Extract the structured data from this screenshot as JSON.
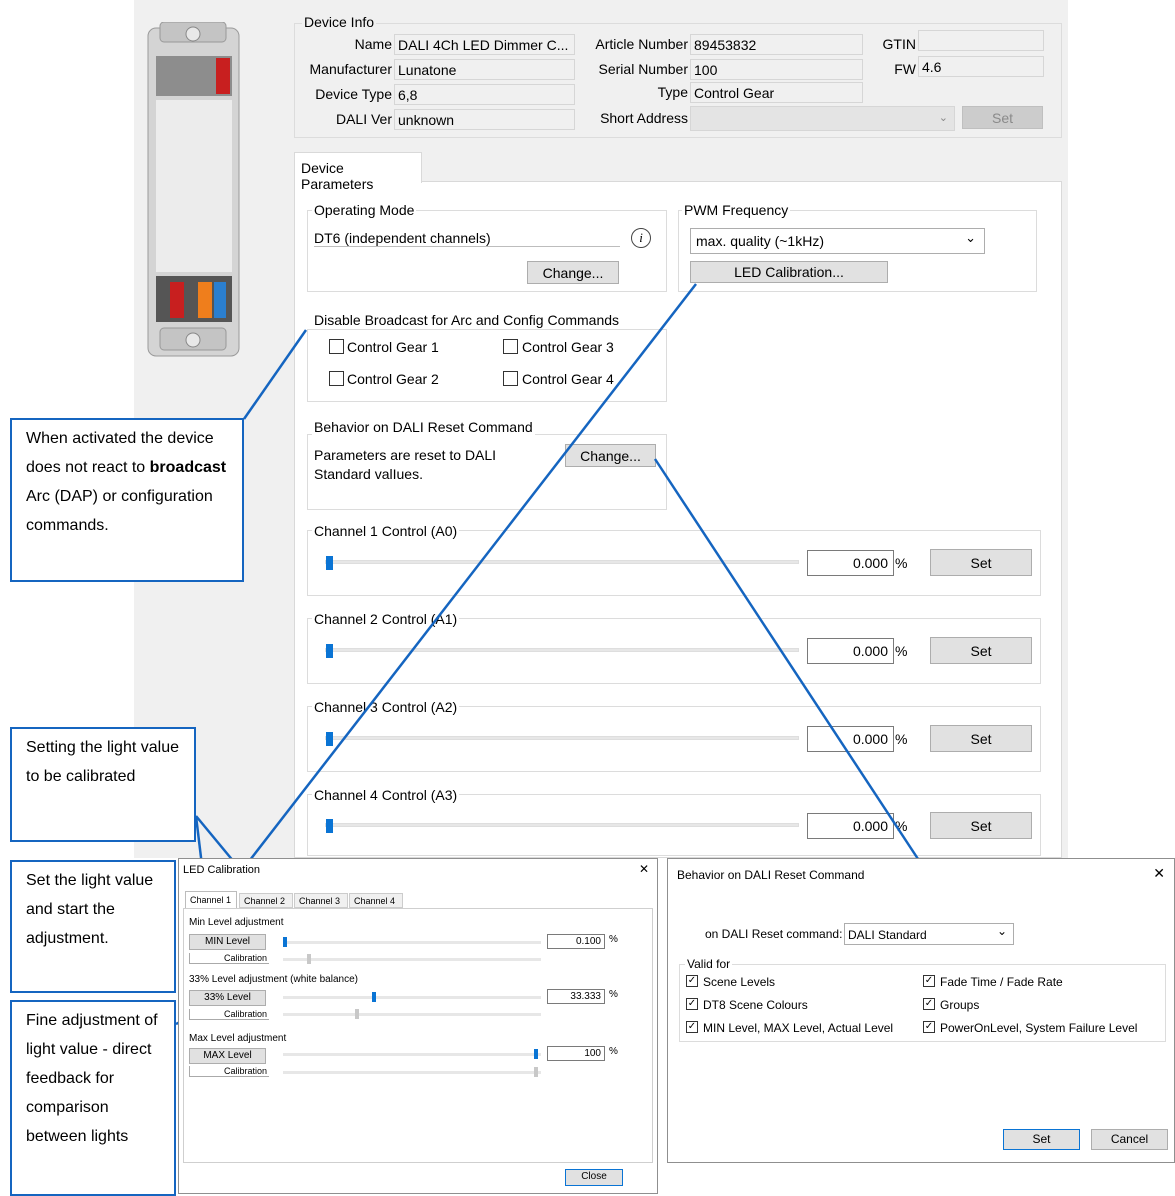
{
  "device_info": {
    "group_title": "Device Info",
    "name_label": "Name",
    "name_value": "DALI 4Ch LED Dimmer C...",
    "manufacturer_label": "Manufacturer",
    "manufacturer_value": "Lunatone",
    "device_type_label": "Device Type",
    "device_type_value": "6,8",
    "dali_ver_label": "DALI Ver",
    "dali_ver_value": "unknown",
    "article_label": "Article Number",
    "article_value": "89453832",
    "serial_label": "Serial Number",
    "serial_value": "100",
    "type_label": "Type",
    "type_value": "Control Gear",
    "short_addr_label": "Short Address",
    "gtin_label": "GTIN",
    "gtin_value": "",
    "fw_label": "FW",
    "fw_value": "4.6",
    "set_label": "Set"
  },
  "tab_label": "Device Parameters",
  "operating_mode": {
    "title": "Operating Mode",
    "value": "DT6 (independent channels)",
    "change_label": "Change...",
    "info_glyph": "i"
  },
  "pwm": {
    "title": "PWM Frequency",
    "value": "max. quality (~1kHz)",
    "led_cal_label": "LED Calibration..."
  },
  "broadcast": {
    "title": "Disable Broadcast for Arc and Config Commands",
    "gear1": "Control Gear 1",
    "gear2": "Control Gear 2",
    "gear3": "Control Gear 3",
    "gear4": "Control Gear 4"
  },
  "reset_behavior": {
    "title": "Behavior on DALI Reset Command",
    "text": "Parameters are reset to DALI Standard valIues.",
    "change_label": "Change..."
  },
  "channels": [
    {
      "title": "Channel 1 Control (A0)",
      "value": "0.000",
      "unit": "%",
      "set": "Set"
    },
    {
      "title": "Channel 2 Control (A1)",
      "value": "0.000",
      "unit": "%",
      "set": "Set"
    },
    {
      "title": "Channel 3 Control (A2)",
      "value": "0.000",
      "unit": "%",
      "set": "Set"
    },
    {
      "title": "Channel 4 Control (A3)",
      "value": "0.000",
      "unit": "%",
      "set": "Set"
    }
  ],
  "notes": {
    "broadcast_pre": "When activated the device does not react to ",
    "broadcast_bold": "broadcast",
    "broadcast_post": " Arc (DAP) or configuration commands.",
    "setting_value": "Setting the light value to be calibrated",
    "set_start": "Set the light value and start the adjustment.",
    "fine_adjust": "Fine adjustment of light value - direct feedback for comparison between lights"
  },
  "led_cal": {
    "title": "LED Calibration",
    "tabs": [
      "Channel 1",
      "Channel 2",
      "Channel 3",
      "Channel 4"
    ],
    "min_group": "Min Level adjustment",
    "min_btn": "MIN Level",
    "min_value": "0.100",
    "mid_group": "33% Level adjustment (white balance)",
    "mid_btn": "33% Level",
    "mid_value": "33.333",
    "max_group": "Max Level adjustment",
    "max_btn": "MAX Level",
    "max_value": "100",
    "calibration": "Calibration",
    "unit": "%",
    "close": "Close",
    "close_glyph": "✕"
  },
  "reset_dialog": {
    "title": "Behavior on DALI Reset Command",
    "on_reset_label": "on DALI Reset command:",
    "on_reset_value": "DALI Standard",
    "valid_for": "Valid for",
    "items_left": [
      "Scene Levels",
      "DT8 Scene Colours",
      "MIN Level, MAX Level, Actual Level"
    ],
    "items_right": [
      "Fade Time / Fade Rate",
      "Groups",
      "PowerOnLevel, System Failure Level"
    ],
    "set": "Set",
    "cancel": "Cancel",
    "close_glyph": "✕"
  }
}
